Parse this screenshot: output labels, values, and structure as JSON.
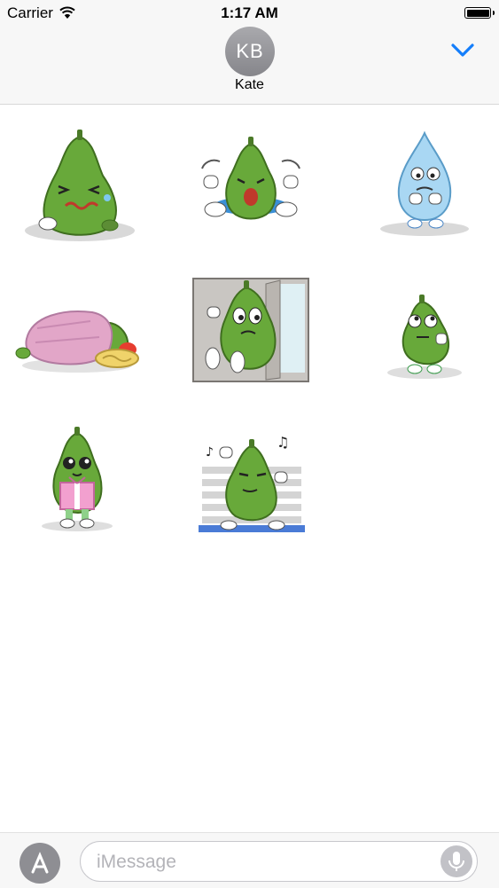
{
  "status_bar": {
    "carrier": "Carrier",
    "time": "1:17 AM"
  },
  "header": {
    "avatar_initials": "KB",
    "contact_name": "Kate"
  },
  "colors": {
    "accent": "#147efb",
    "avatar_gray": "#8e8e93",
    "pear_green": "#63a833"
  },
  "stickers": [
    {
      "icon": "crying-pear-sticker"
    },
    {
      "icon": "tantrum-pear-sticker"
    },
    {
      "icon": "scared-water-drop-sticker"
    },
    {
      "icon": "sleeping-pear-sticker"
    },
    {
      "icon": "peeking-pear-door-sticker"
    },
    {
      "icon": "thinking-pear-sticker"
    },
    {
      "icon": "gift-pear-sticker"
    },
    {
      "icon": "dancing-pear-sticker"
    }
  ],
  "compose": {
    "placeholder": "iMessage"
  }
}
